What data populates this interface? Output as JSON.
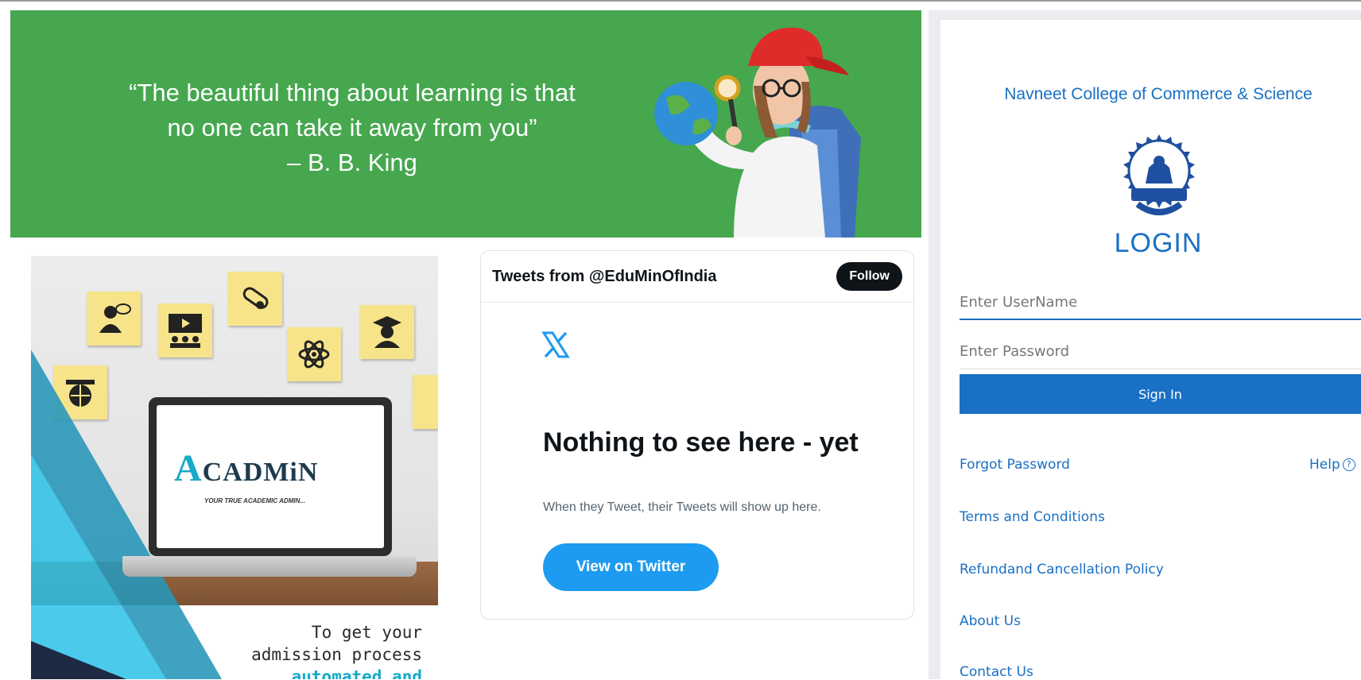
{
  "banner": {
    "quote_line1": "“The beautiful thing about learning is that",
    "quote_line2": "no one can take it away from you”",
    "quote_author": "– B. B. King"
  },
  "promo": {
    "brand_a": "A",
    "brand_rest": "CADMiN",
    "tagline": "YOUR TRUE ACADEMIC ADMIN...",
    "text_line1": "To get your",
    "text_line2": "admission process",
    "text_line3": "automated and"
  },
  "twitter": {
    "title": "Tweets from @EduMinOfIndia",
    "follow_label": "Follow",
    "empty_title": "Nothing to see here - yet",
    "empty_sub": "When they Tweet, their Tweets will show up here.",
    "view_label": "View on Twitter"
  },
  "login": {
    "college_name": "Navneet College of Commerce & Science",
    "title": "LOGIN",
    "username_placeholder": "Enter UserName",
    "password_placeholder": "Enter Password",
    "signin_label": "Sign In",
    "forgot_label": "Forgot Password",
    "help_label": "Help",
    "terms_label": "Terms and Conditions",
    "refund_label": "Refundand Cancellation Policy",
    "about_label": "About Us",
    "contact_label": "Contact Us"
  },
  "colors": {
    "banner_green": "#46a74f",
    "primary_blue": "#1a70c4",
    "twitter_blue": "#1d9bf0",
    "acadmin_cyan": "#17a9c9"
  },
  "icons": [
    "x-logo-icon",
    "help-circle-icon",
    "college-emblem",
    "acadmin-logo"
  ]
}
